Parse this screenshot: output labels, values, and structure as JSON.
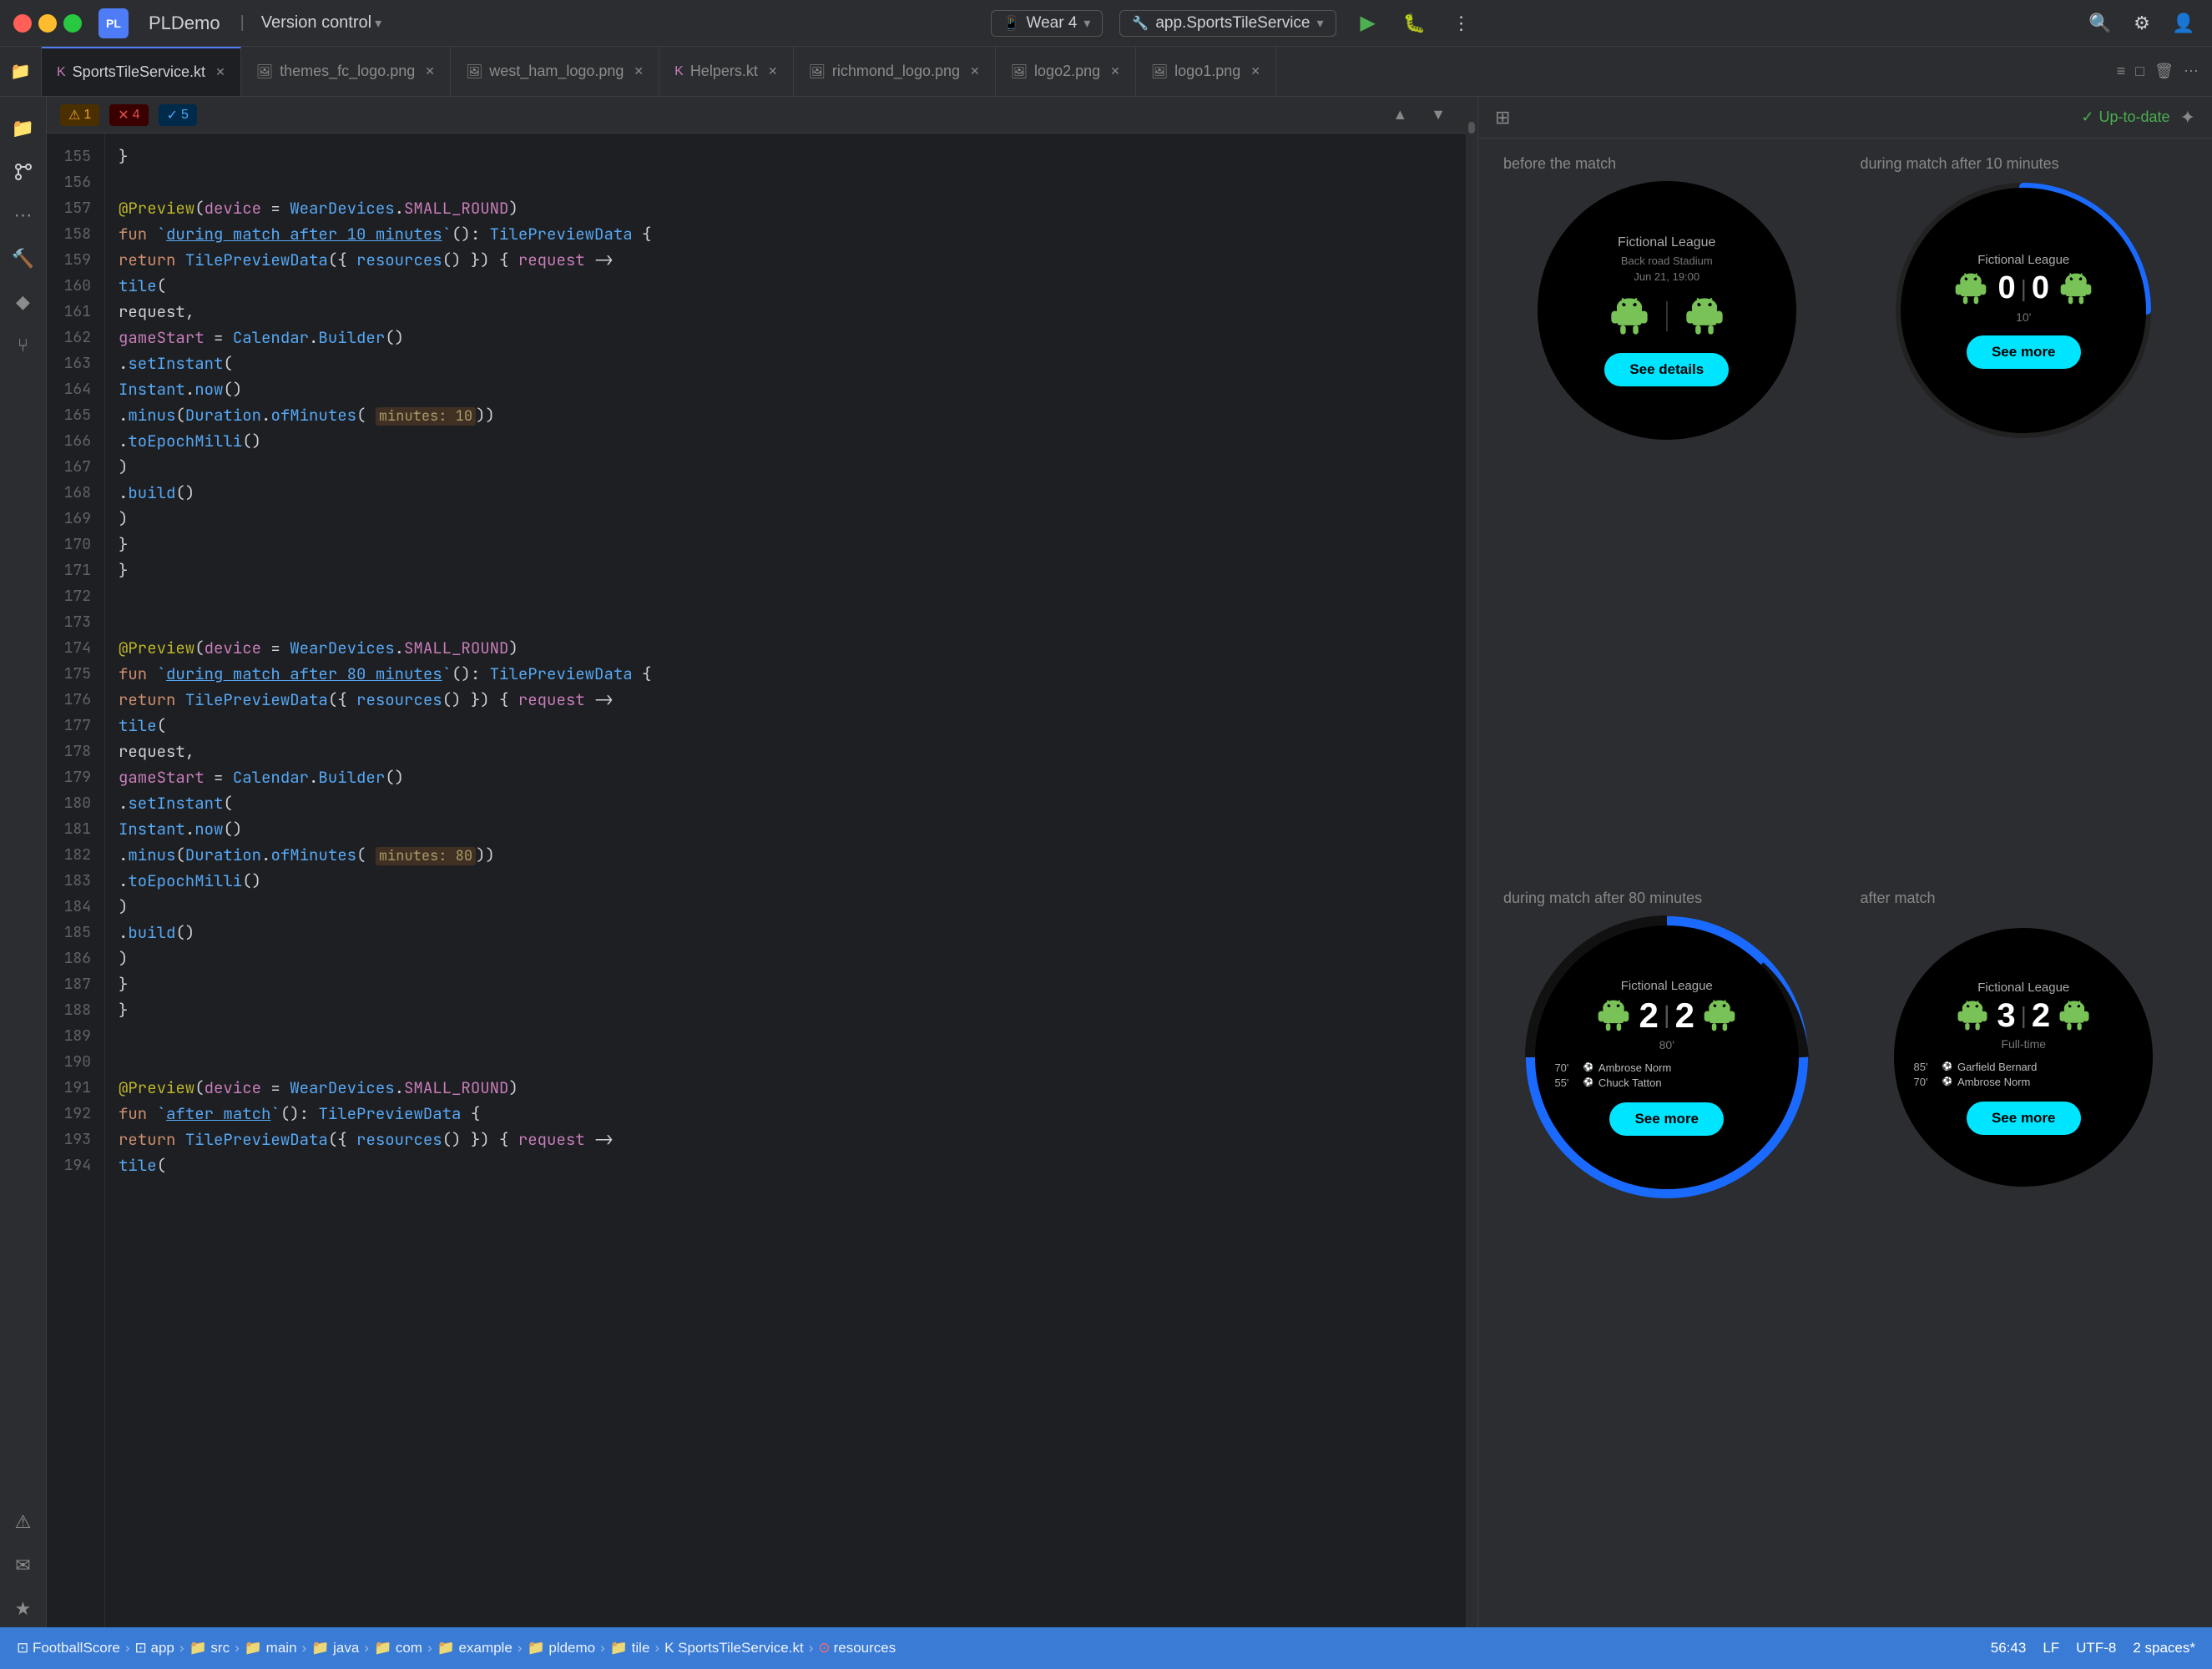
{
  "app": {
    "name": "PLDemo",
    "version_control": "Version control",
    "wear_label": "Wear 4",
    "service_label": "app.SportsTileService",
    "up_to_date": "Up-to-date"
  },
  "tabs": [
    {
      "id": "sports-tile",
      "label": "SportsTileService.kt",
      "active": true,
      "icon": "kotlin"
    },
    {
      "id": "themes-logo",
      "label": "themes_fc_logo.png",
      "active": false,
      "icon": "image"
    },
    {
      "id": "west-ham",
      "label": "west_ham_logo.png",
      "active": false,
      "icon": "image"
    },
    {
      "id": "helpers",
      "label": "Helpers.kt",
      "active": false,
      "icon": "kotlin"
    },
    {
      "id": "richmond",
      "label": "richmond_logo.png",
      "active": false,
      "icon": "image"
    },
    {
      "id": "logo2",
      "label": "logo2.png",
      "active": false,
      "icon": "image"
    },
    {
      "id": "logo1",
      "label": "logo1.png",
      "active": false,
      "icon": "image"
    }
  ],
  "editor": {
    "warnings": "1",
    "errors": "4",
    "info": "5",
    "lines": [
      {
        "num": 155,
        "content": "    }"
      },
      {
        "num": 156,
        "content": ""
      },
      {
        "num": 157,
        "content": "    @Preview(device = WearDevices.SMALL_ROUND)"
      },
      {
        "num": 158,
        "content": "    fun `during match after 10 minutes`(): TilePreviewData {"
      },
      {
        "num": 159,
        "content": "        return TilePreviewData({ resources() }) { request ->"
      },
      {
        "num": 160,
        "content": "            tile("
      },
      {
        "num": 161,
        "content": "                request,"
      },
      {
        "num": 162,
        "content": "                gameStart = Calendar.Builder()"
      },
      {
        "num": 163,
        "content": "                    .setInstant("
      },
      {
        "num": 164,
        "content": "                        Instant.now()"
      },
      {
        "num": 165,
        "content": "                            .minus(Duration.ofMinutes( minutes: 10))"
      },
      {
        "num": 166,
        "content": "                            .toEpochMilli()"
      },
      {
        "num": 167,
        "content": "                    )"
      },
      {
        "num": 168,
        "content": "                    .build()"
      },
      {
        "num": 169,
        "content": "            )"
      },
      {
        "num": 170,
        "content": "        }"
      },
      {
        "num": 171,
        "content": "    }"
      },
      {
        "num": 172,
        "content": ""
      },
      {
        "num": 173,
        "content": ""
      },
      {
        "num": 174,
        "content": "    @Preview(device = WearDevices.SMALL_ROUND)"
      },
      {
        "num": 175,
        "content": "    fun `during match after 80 minutes`(): TilePreviewData {"
      },
      {
        "num": 176,
        "content": "        return TilePreviewData({ resources() }) { request ->"
      },
      {
        "num": 177,
        "content": "            tile("
      },
      {
        "num": 178,
        "content": "                request,"
      },
      {
        "num": 179,
        "content": "                gameStart = Calendar.Builder()"
      },
      {
        "num": 180,
        "content": "                    .setInstant("
      },
      {
        "num": 181,
        "content": "                        Instant.now()"
      },
      {
        "num": 182,
        "content": "                            .minus(Duration.ofMinutes( minutes: 80))"
      },
      {
        "num": 183,
        "content": "                            .toEpochMilli()"
      },
      {
        "num": 184,
        "content": "                    )"
      },
      {
        "num": 185,
        "content": "                    .build()"
      },
      {
        "num": 186,
        "content": "        )"
      },
      {
        "num": 187,
        "content": "        }"
      },
      {
        "num": 188,
        "content": "    }"
      },
      {
        "num": 189,
        "content": ""
      },
      {
        "num": 190,
        "content": ""
      },
      {
        "num": 191,
        "content": "    @Preview(device = WearDevices.SMALL_ROUND)"
      },
      {
        "num": 192,
        "content": "    fun `after match`(): TilePreviewData {"
      },
      {
        "num": 193,
        "content": "        return TilePreviewData({ resources() }) { request ->"
      },
      {
        "num": 194,
        "content": "            tile("
      }
    ]
  },
  "preview": {
    "panels": [
      {
        "id": "before-match",
        "label": "before the match",
        "type": "before",
        "league": "Fictional League",
        "venue": "Back road Stadium",
        "date": "Jun 21, 19:00",
        "score_left": null,
        "score_right": null,
        "minute": null,
        "btn_label": "See details",
        "events": []
      },
      {
        "id": "during-10",
        "label": "during match after 10 minutes",
        "type": "during-10",
        "league": "Fictional League",
        "score_left": "0",
        "score_right": "0",
        "minute": "10'",
        "btn_label": "See more",
        "events": []
      },
      {
        "id": "during-80",
        "label": "during match after 80 minutes",
        "type": "during-80",
        "league": "Fictional League",
        "score_left": "2",
        "score_right": "2",
        "minute": "80'",
        "btn_label": "See more",
        "events": [
          {
            "min": "70'",
            "name": "Ambrose Norm"
          },
          {
            "min": "55'",
            "name": "Chuck Tatton"
          }
        ]
      },
      {
        "id": "after-match",
        "label": "after match",
        "type": "after",
        "league": "Fictional League",
        "score_left": "3",
        "score_right": "2",
        "minute": "Full-time",
        "btn_label": "See more",
        "events": [
          {
            "min": "85'",
            "name": "Garfield Bernard"
          },
          {
            "min": "70'",
            "name": "Ambrose Norm"
          }
        ]
      }
    ]
  },
  "status_bar": {
    "breadcrumb_items": [
      "FootballScore",
      "app",
      "src",
      "main",
      "java",
      "com",
      "example",
      "pldemo",
      "tile",
      "SportsTileService.kt",
      "resources"
    ],
    "position": "56:43",
    "encoding": "UTF-8",
    "line_sep": "LF",
    "indent": "2 spaces*"
  }
}
